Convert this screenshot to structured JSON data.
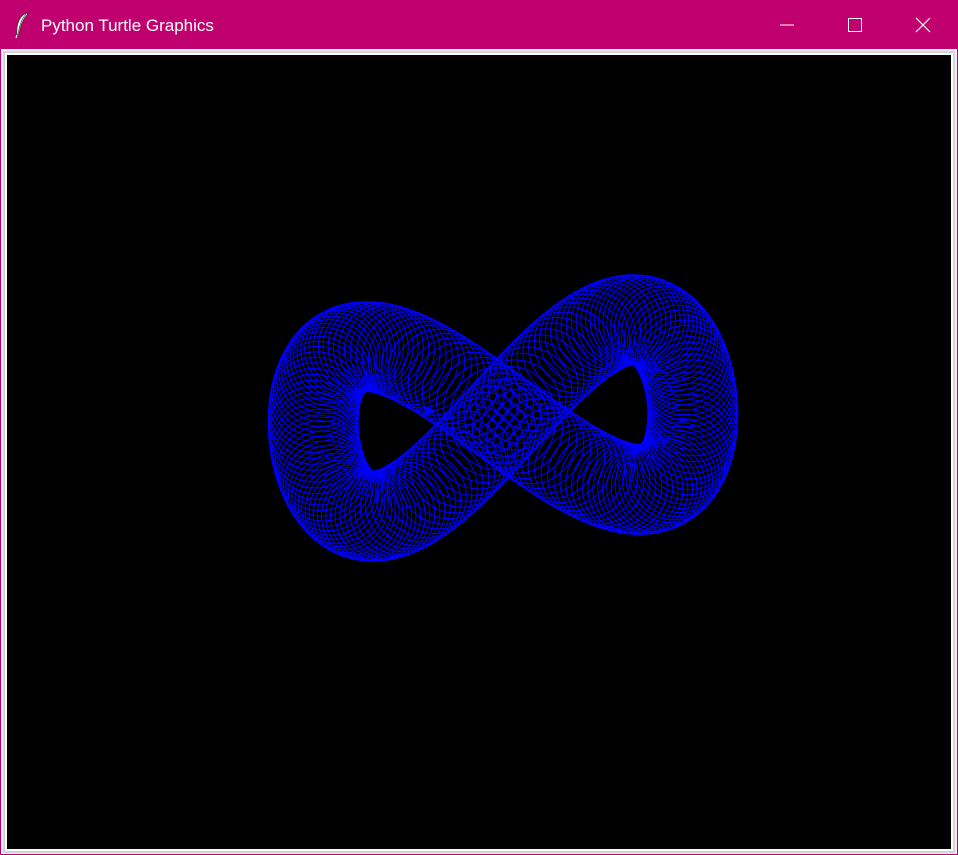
{
  "window": {
    "title": "Python Turtle Graphics",
    "icon": "feather-icon",
    "titlebar_color": "#c0006f",
    "controls": [
      {
        "name": "minimize",
        "icon": "minimize-icon"
      },
      {
        "name": "maximize",
        "icon": "maximize-icon"
      },
      {
        "name": "close",
        "icon": "close-icon"
      }
    ]
  },
  "canvas": {
    "background": "#000000",
    "pen_color": "#0000ff",
    "drawing": "figure-eight-of-circles",
    "circle_count": 180,
    "turtle_icon": "turtle-arrow-icon"
  }
}
